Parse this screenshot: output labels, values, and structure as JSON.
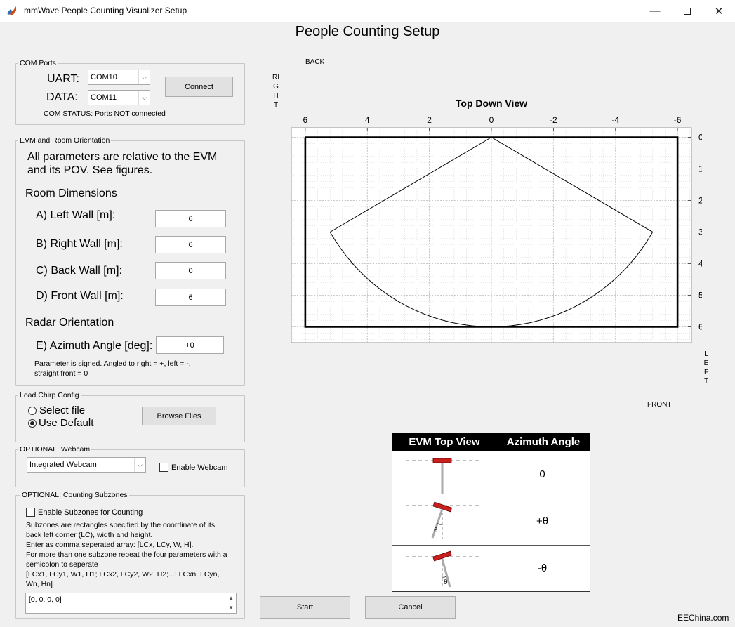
{
  "window": {
    "title": "mmWave People Counting Visualizer Setup"
  },
  "page_title": "People Counting Setup",
  "com_ports": {
    "legend": "COM Ports",
    "uart_label": "UART:",
    "uart_value": "COM10",
    "data_label": "DATA:",
    "data_value": "COM11",
    "connect_label": "Connect",
    "status": "COM STATUS: Ports NOT connected"
  },
  "evm_room": {
    "legend": "EVM and Room Orientation",
    "intro_line1": "All parameters are relative to the EVM",
    "intro_line2": "and its POV.  See figures.",
    "room_heading": "Room Dimensions",
    "left_wall_label": "A) Left Wall [m]:",
    "left_wall_value": "6",
    "right_wall_label": "B) Right Wall [m]:",
    "right_wall_value": "6",
    "back_wall_label": "C) Back Wall [m]:",
    "back_wall_value": "0",
    "front_wall_label": "D) Front Wall [m]:",
    "front_wall_value": "6",
    "radar_heading": "Radar Orientation",
    "azimuth_label": "E) Azimuth Angle [deg]:",
    "azimuth_value": "+0",
    "note_line1": "Parameter is signed. Angled to right = +, left = -,",
    "note_line2": "straight front = 0"
  },
  "chirp": {
    "legend": "Load Chirp Config",
    "select_file": "Select file",
    "use_default": "Use Default",
    "selected": "use_default",
    "browse_label": "Browse Files"
  },
  "webcam": {
    "legend": "OPTIONAL: Webcam",
    "device_value": "Integrated Webcam",
    "enable_label": "Enable Webcam",
    "enabled": false
  },
  "subzones": {
    "legend": "OPTIONAL: Counting Subzones",
    "enable_label": "Enable Subzones for Counting",
    "enabled": false,
    "desc_line1": "Subzones are rectangles specified by the coordinate of its",
    "desc_line2": "back left corner (LC), width and height.",
    "desc_line3": "Enter as comma seperated array: [LCx, LCy, W, H].",
    "desc_line4": "For more than one subzone repeat the four parameters with a",
    "desc_line5": "semicolon to seperate",
    "desc_line6": "[LCx1, LCy1, W1, H1; LCx2, LCy2, W2, H2;...; LCxn, LCyn,",
    "desc_line7": "Wn, Hn].",
    "input_value": "[0, 0, 0, 0]"
  },
  "plot": {
    "title": "Top Down View",
    "back_label": "BACK",
    "front_label": "FRONT",
    "right_label": "RIGHT",
    "left_label": "LEFT",
    "x_ticks": [
      "6",
      "4",
      "2",
      "0",
      "-2",
      "-4",
      "-6"
    ],
    "y_ticks": [
      "0",
      "1",
      "2",
      "3",
      "4",
      "5",
      "6"
    ]
  },
  "chart_data": {
    "type": "line",
    "title": "Top Down View",
    "xlim": [
      6,
      -6
    ],
    "ylim": [
      0,
      6
    ],
    "y_reversed": true,
    "grid": true,
    "minor_grid": true,
    "series": [
      {
        "role": "room_boundary",
        "x": [
          6,
          -6,
          -6,
          6,
          6
        ],
        "y": [
          0,
          0,
          6,
          6,
          0
        ]
      },
      {
        "role": "radar_fov",
        "x": [
          0,
          5.2,
          0,
          -5.2,
          0
        ],
        "y": [
          0,
          3,
          6,
          3,
          0
        ],
        "arc_from_center": [
          0,
          0
        ],
        "arc_radius": 6
      }
    ]
  },
  "azimuth_table": {
    "col1_header": "EVM Top View",
    "col2_header": "Azimuth Angle",
    "rows": [
      {
        "angle": "0",
        "theta_label": ""
      },
      {
        "angle": "+θ",
        "theta_label": "θ"
      },
      {
        "angle": "-θ",
        "theta_label": "θ"
      }
    ]
  },
  "actions": {
    "start_label": "Start",
    "cancel_label": "Cancel"
  },
  "watermark": "EEChina.com",
  "colors": {
    "accent_red": "#c8201e",
    "panel_bg": "#f0f0f0"
  }
}
